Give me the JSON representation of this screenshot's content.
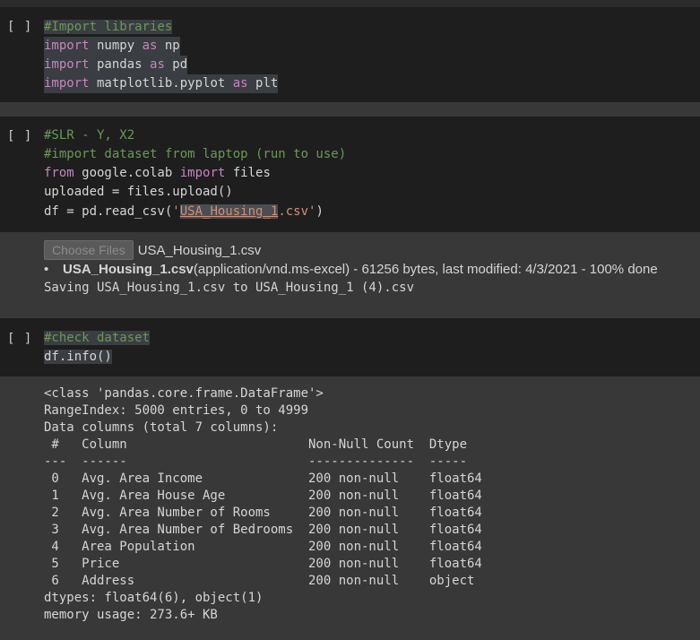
{
  "cells": {
    "c1": {
      "bracket": "[ ]",
      "lines": [
        "#Import libraries",
        [
          "import",
          " numpy ",
          "as",
          " np"
        ],
        [
          "import",
          " pandas ",
          "as",
          " pd"
        ],
        [
          "import",
          " matplotlib.pyplot ",
          "as",
          " plt"
        ]
      ]
    },
    "c2": {
      "bracket": "[ ]",
      "comment1": "#SLR - Y, X2",
      "comment2": "#import dataset from laptop (run to use)",
      "from_kw": "from",
      "from_mod": " google.colab ",
      "import_kw": "import",
      "from_rest": " files",
      "upload_line": "uploaded = files.upload()",
      "read_pre": "df = pd.read_csv(",
      "read_q1": "'",
      "read_sel": "USA_Housing_1",
      "read_ext": ".csv'",
      "read_post": ")"
    },
    "out2": {
      "choose_files": "Choose Files",
      "chosen_file": "USA_Housing_1.csv",
      "file_name": "USA_Housing_1.csv",
      "file_meta": "(application/vnd.ms-excel) - 61256 bytes, last modified: 4/3/2021 - 100% done",
      "saving": "Saving USA_Housing_1.csv to USA_Housing_1 (4).csv"
    },
    "c3": {
      "bracket": "[ ]",
      "comment": "#check dataset",
      "code": "df.info()"
    },
    "out3": {
      "lines": [
        "<class 'pandas.core.frame.DataFrame'>",
        "RangeIndex: 5000 entries, 0 to 4999",
        "Data columns (total 7 columns):",
        " #   Column                        Non-Null Count  Dtype  ",
        "---  ------                        --------------  -----  ",
        " 0   Avg. Area Income              200 non-null    float64",
        " 1   Avg. Area House Age           200 non-null    float64",
        " 2   Avg. Area Number of Rooms     200 non-null    float64",
        " 3   Avg. Area Number of Bedrooms  200 non-null    float64",
        " 4   Area Population               200 non-null    float64",
        " 5   Price                         200 non-null    float64",
        " 6   Address                       200 non-null    object ",
        "dtypes: float64(6), object(1)",
        "memory usage: 273.6+ KB"
      ]
    }
  },
  "colors": {
    "background": "#383838",
    "code_bg": "#1e1e1e",
    "comment": "#6a9955",
    "keyword": "#c586c0",
    "string": "#ce9178"
  }
}
